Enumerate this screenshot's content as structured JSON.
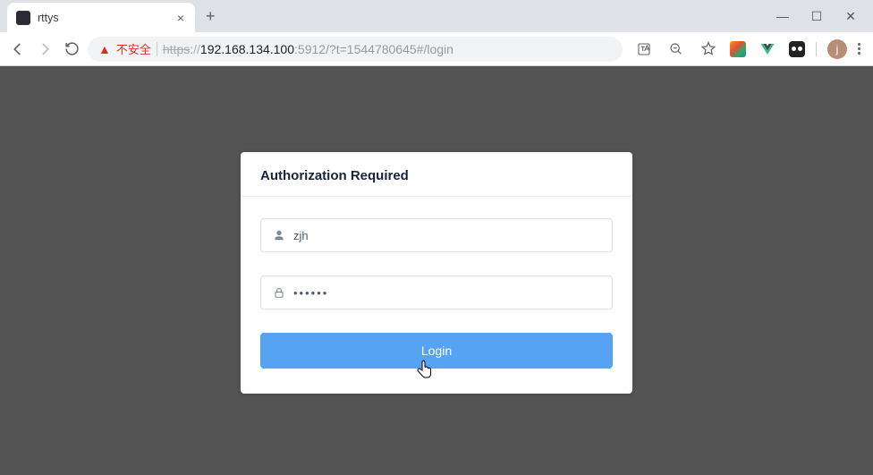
{
  "window": {
    "tab_title": "rttys"
  },
  "omnibox": {
    "insecure_label": "不安全",
    "protocol": "https",
    "sep": "://",
    "host": "192.168.134.100",
    "port": ":5912",
    "path": "/?t=1544780645#/login"
  },
  "profile": {
    "initial": "j"
  },
  "login": {
    "title": "Authorization Required",
    "username_value": "zjh",
    "password_value": "······",
    "button_label": "Login"
  }
}
